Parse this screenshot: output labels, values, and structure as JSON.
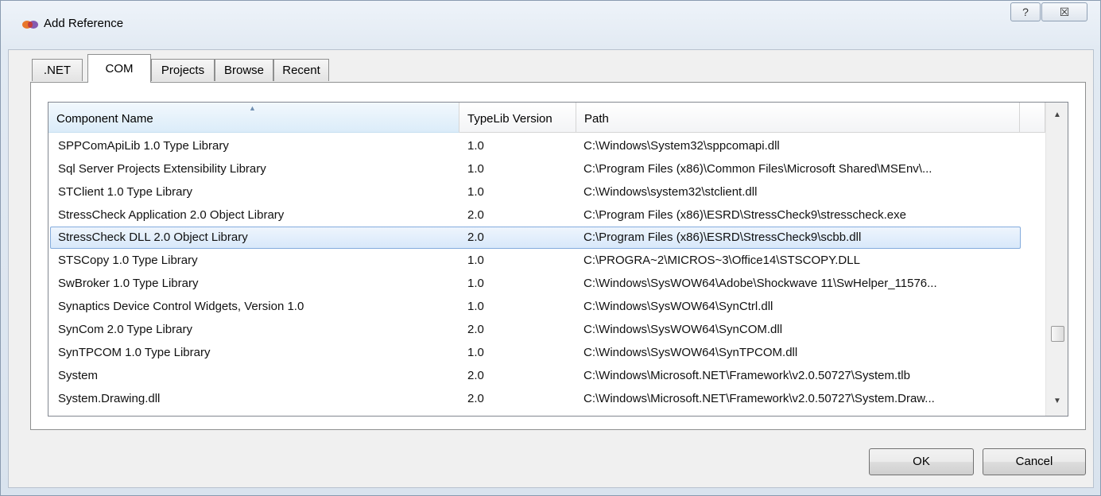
{
  "window": {
    "title": "Add Reference",
    "help_glyph": "?",
    "close_glyph": "☒"
  },
  "tabs": [
    {
      "label": ".NET",
      "active": false
    },
    {
      "label": "COM",
      "active": true
    },
    {
      "label": "Projects",
      "active": false
    },
    {
      "label": "Browse",
      "active": false
    },
    {
      "label": "Recent",
      "active": false
    }
  ],
  "list": {
    "columns": [
      "Component Name",
      "TypeLib Version",
      "Path"
    ],
    "sorted_column": "Component Name",
    "rows": [
      {
        "name": "SPPComApiLib 1.0 Type Library",
        "version": "1.0",
        "path": "C:\\Windows\\System32\\sppcomapi.dll",
        "selected": false
      },
      {
        "name": "Sql Server Projects Extensibility Library",
        "version": "1.0",
        "path": "C:\\Program Files (x86)\\Common Files\\Microsoft Shared\\MSEnv\\...",
        "selected": false
      },
      {
        "name": "STClient 1.0 Type Library",
        "version": "1.0",
        "path": "C:\\Windows\\system32\\stclient.dll",
        "selected": false
      },
      {
        "name": "StressCheck Application 2.0 Object Library",
        "version": "2.0",
        "path": "C:\\Program Files (x86)\\ESRD\\StressCheck9\\stresscheck.exe",
        "selected": false
      },
      {
        "name": "StressCheck DLL 2.0 Object Library",
        "version": "2.0",
        "path": "C:\\Program Files (x86)\\ESRD\\StressCheck9\\scbb.dll",
        "selected": true
      },
      {
        "name": "STSCopy 1.0 Type Library",
        "version": "1.0",
        "path": "C:\\PROGRA~2\\MICROS~3\\Office14\\STSCOPY.DLL",
        "selected": false
      },
      {
        "name": "SwBroker 1.0 Type Library",
        "version": "1.0",
        "path": "C:\\Windows\\SysWOW64\\Adobe\\Shockwave 11\\SwHelper_11576...",
        "selected": false
      },
      {
        "name": "Synaptics Device Control Widgets, Version 1.0",
        "version": "1.0",
        "path": "C:\\Windows\\SysWOW64\\SynCtrl.dll",
        "selected": false
      },
      {
        "name": "SynCom 2.0 Type Library",
        "version": "2.0",
        "path": "C:\\Windows\\SysWOW64\\SynCOM.dll",
        "selected": false
      },
      {
        "name": "SynTPCOM 1.0 Type Library",
        "version": "1.0",
        "path": "C:\\Windows\\SysWOW64\\SynTPCOM.dll",
        "selected": false
      },
      {
        "name": "System",
        "version": "2.0",
        "path": "C:\\Windows\\Microsoft.NET\\Framework\\v2.0.50727\\System.tlb",
        "selected": false
      },
      {
        "name": "System.Drawing.dll",
        "version": "2.0",
        "path": "C:\\Windows\\Microsoft.NET\\Framework\\v2.0.50727\\System.Draw...",
        "selected": false
      }
    ]
  },
  "buttons": {
    "ok": "OK",
    "cancel": "Cancel"
  },
  "colors": {
    "selection_border": "#84acdd",
    "selection_fill": "#d8e8fa"
  }
}
